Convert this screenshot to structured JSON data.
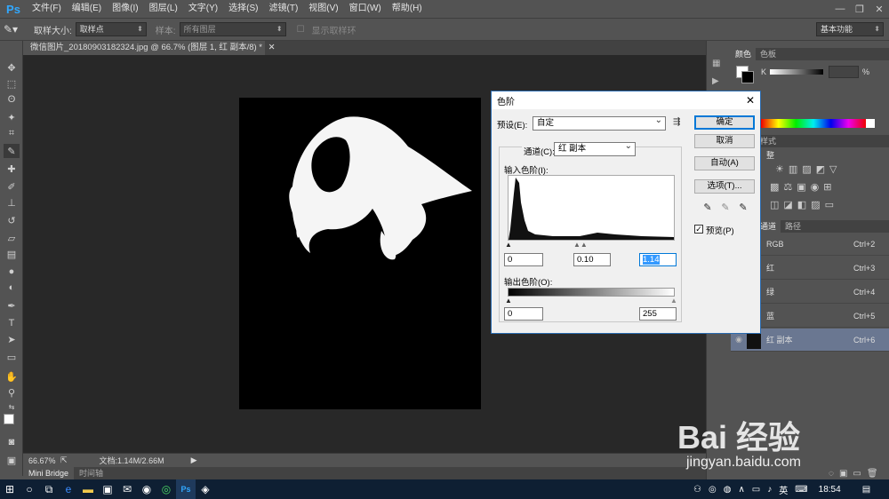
{
  "app": {
    "logo": "Ps"
  },
  "menus": [
    "文件(F)",
    "编辑(E)",
    "图像(I)",
    "图层(L)",
    "文字(Y)",
    "选择(S)",
    "滤镜(T)",
    "视图(V)",
    "窗口(W)",
    "帮助(H)"
  ],
  "options": {
    "sample_size_label": "取样大小:",
    "sample_size_value": "取样点",
    "sample_label": "样本:",
    "sample_value": "所有图层",
    "show_ring_label": "显示取样环",
    "workspace": "基本功能"
  },
  "document": {
    "tab_title": "微信图片_20180903182324.jpg @ 66.7% (图层 1, 红 副本/8) *",
    "zoom": "66.67%",
    "doc_info": "文档:1.14M/2.66M"
  },
  "bottom_tabs": [
    "Mini Bridge",
    "时间轴"
  ],
  "panels": {
    "color_tabs": [
      "颜色",
      "色板"
    ],
    "k_label": "K",
    "k_unit": "%",
    "adjust_tabs": [
      "样式"
    ],
    "adjust_title": "整",
    "layer_tabs": [
      "通道",
      "路径"
    ],
    "channels": [
      {
        "name": "RGB",
        "shortcut": "Ctrl+2"
      },
      {
        "name": "红",
        "shortcut": "Ctrl+3"
      },
      {
        "name": "绿",
        "shortcut": "Ctrl+4"
      },
      {
        "name": "蓝",
        "shortcut": "Ctrl+5"
      },
      {
        "name": "红 副本",
        "shortcut": "Ctrl+6"
      }
    ]
  },
  "levels_dialog": {
    "title": "色阶",
    "preset_label": "预设(E):",
    "preset_value": "自定",
    "channel_label": "通道(C):",
    "channel_value": "红 副本",
    "input_label": "输入色阶(I):",
    "input_values": [
      "0",
      "0.10",
      "1.14"
    ],
    "output_label": "输出色阶(O):",
    "output_values": [
      "0",
      "255"
    ],
    "buttons": {
      "ok": "确定",
      "cancel": "取消",
      "auto": "自动(A)",
      "options": "选项(T)..."
    },
    "preview_label": "预览(P)"
  },
  "taskbar": {
    "time": "18:54",
    "ime": "英"
  },
  "watermark": {
    "text": "Bai 经验",
    "url": "jingyan.baidu.com"
  }
}
